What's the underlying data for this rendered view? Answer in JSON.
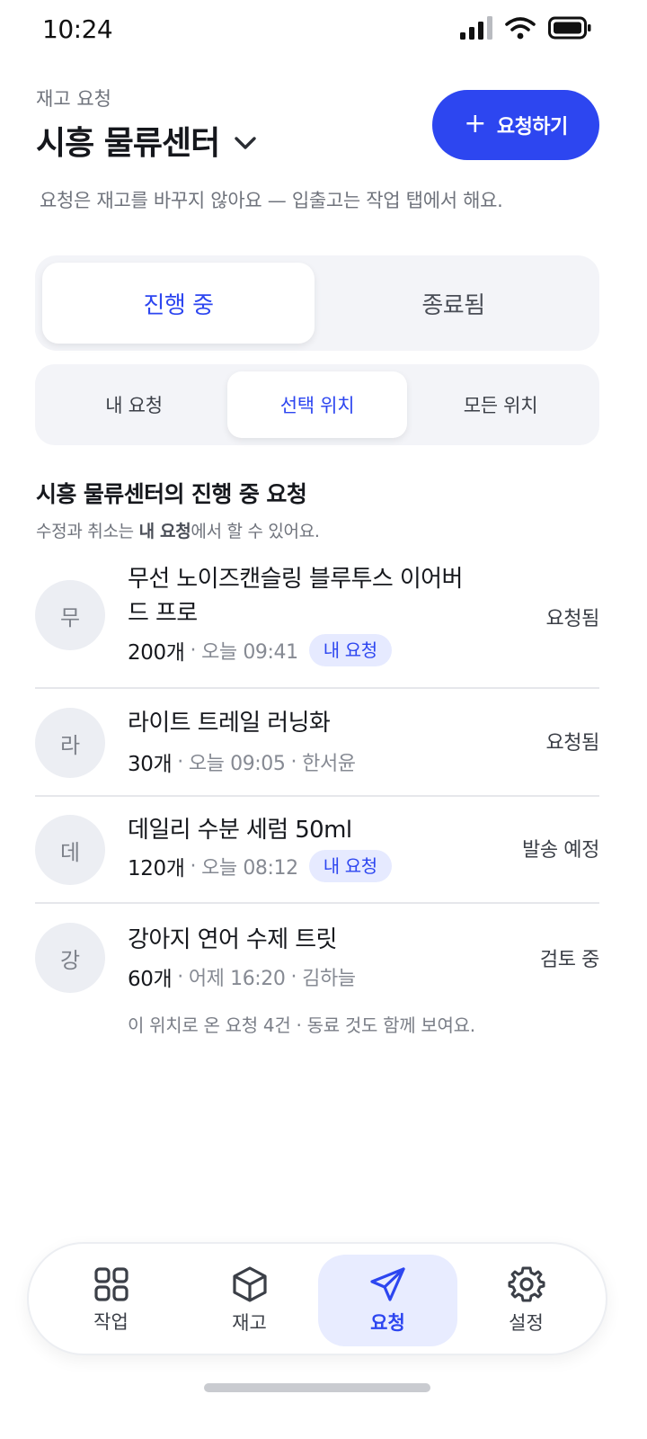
{
  "status_bar": {
    "time": "10:24"
  },
  "header": {
    "eyebrow": "재고 요청",
    "title": "시흥 물류센터",
    "request_button_icon": "+",
    "request_button": "요청하기",
    "subtitle": "요청은 재고를 바꾸지 않아요 — 입출고는 작업 탭에서 해요."
  },
  "state_tabs": {
    "active": "진행 중",
    "inactive": "종료됨"
  },
  "scope_tabs": {
    "mine": "내 요청",
    "selected": "선택 위치",
    "all": "모든 위치",
    "active_index": 1
  },
  "section": {
    "title": "시흥 물류센터의 진행 중 요청",
    "hint_bold": "내 요청",
    "hint_pre": "수정과 취소는 ",
    "hint_post": "에서 할 수 있어요."
  },
  "requests": [
    {
      "initial": "무",
      "name": "무선 노이즈캔슬링 블루투스 이어버드 프로",
      "qty": "200개",
      "time": "오늘 09:41",
      "tag": "내 요청",
      "requester": "",
      "status": "요청됨"
    },
    {
      "initial": "라",
      "name": "라이트 트레일 러닝화",
      "qty": "30개",
      "time": "오늘 09:05",
      "tag": "",
      "requester": "한서윤",
      "status": "요청됨"
    },
    {
      "initial": "데",
      "name": "데일리 수분 세럼 50ml",
      "qty": "120개",
      "time": "오늘 08:12",
      "tag": "내 요청",
      "requester": "",
      "status": "발송 예정"
    },
    {
      "initial": "강",
      "name": "강아지 연어 수제 트릿",
      "qty": "60개",
      "time": "어제 16:20",
      "tag": "",
      "requester": "김하늘",
      "status": "검토 중"
    }
  ],
  "footnote": "이 위치로 온 요청 4건 · 동료 것도 함께 보여요.",
  "bottom_nav": [
    {
      "label": "작업",
      "icon": "grid-icon"
    },
    {
      "label": "재고",
      "icon": "box-icon"
    },
    {
      "label": "요청",
      "icon": "send-icon",
      "active": true
    },
    {
      "label": "설정",
      "icon": "gear-icon"
    }
  ],
  "colors": {
    "accent": "#2d46f0",
    "accent_soft": "#e6eaff",
    "muted": "#6f737c"
  }
}
